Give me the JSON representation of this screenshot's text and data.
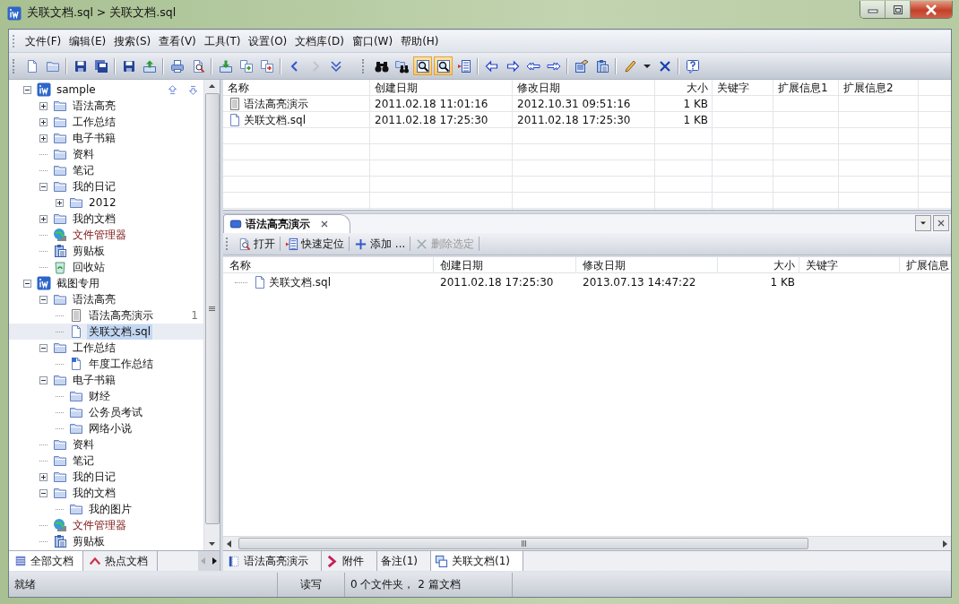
{
  "window": {
    "title": "关联文档.sql > 关联文档.sql"
  },
  "menu": [
    {
      "label": "文件(F)"
    },
    {
      "label": "编辑(E)"
    },
    {
      "label": "搜索(S)"
    },
    {
      "label": "查看(V)"
    },
    {
      "label": "工具(T)"
    },
    {
      "label": "设置(O)"
    },
    {
      "label": "文档库(D)"
    },
    {
      "label": "窗口(W)"
    },
    {
      "label": "帮助(H)"
    }
  ],
  "toolbar": [
    {
      "kind": "new",
      "pressed": false,
      "disabled": false
    },
    {
      "kind": "open",
      "pressed": false,
      "disabled": false
    },
    {
      "kind": "separator"
    },
    {
      "kind": "save",
      "pressed": false,
      "disabled": false
    },
    {
      "kind": "saveall",
      "pressed": false,
      "disabled": false
    },
    {
      "kind": "separator"
    },
    {
      "kind": "savedisk",
      "pressed": false,
      "disabled": false
    },
    {
      "kind": "export",
      "pressed": false,
      "disabled": false
    },
    {
      "kind": "separator"
    },
    {
      "kind": "print",
      "pressed": false,
      "disabled": false
    },
    {
      "kind": "preview",
      "pressed": false,
      "disabled": false
    },
    {
      "kind": "separator"
    },
    {
      "kind": "import",
      "pressed": false,
      "disabled": false
    },
    {
      "kind": "copy",
      "pressed": false,
      "disabled": false
    },
    {
      "kind": "move",
      "pressed": false,
      "disabled": false
    },
    {
      "kind": "separator"
    },
    {
      "kind": "back",
      "pressed": false,
      "disabled": false
    },
    {
      "kind": "forward",
      "pressed": false,
      "disabled": true
    },
    {
      "kind": "expand",
      "pressed": false,
      "disabled": false
    },
    {
      "kind": "grip"
    },
    {
      "kind": "find",
      "pressed": false,
      "disabled": false
    },
    {
      "kind": "findfolder",
      "pressed": false,
      "disabled": false
    },
    {
      "kind": "zoom",
      "pressed": true,
      "disabled": false
    },
    {
      "kind": "search",
      "pressed": true,
      "disabled": false
    },
    {
      "kind": "locate",
      "pressed": false,
      "disabled": false
    },
    {
      "kind": "separator"
    },
    {
      "kind": "prev",
      "pressed": false,
      "disabled": false
    },
    {
      "kind": "next",
      "pressed": false,
      "disabled": false
    },
    {
      "kind": "first",
      "pressed": false,
      "disabled": false
    },
    {
      "kind": "last",
      "pressed": false,
      "disabled": false
    },
    {
      "kind": "separator"
    },
    {
      "kind": "properties",
      "pressed": false,
      "disabled": false
    },
    {
      "kind": "paste",
      "pressed": false,
      "disabled": false
    },
    {
      "kind": "separator"
    },
    {
      "kind": "edit",
      "pressed": false,
      "disabled": false
    },
    {
      "kind": "dropdown",
      "pressed": false,
      "disabled": false
    },
    {
      "kind": "delete",
      "pressed": false,
      "disabled": false
    },
    {
      "kind": "separator"
    },
    {
      "kind": "help",
      "pressed": false,
      "disabled": false
    }
  ],
  "tree": [
    {
      "label": "sample",
      "kind": "library",
      "expanded": true,
      "selected": false,
      "children": [
        {
          "label": "语法高亮",
          "kind": "folder",
          "expanded": false,
          "selected": false
        },
        {
          "label": "工作总结",
          "kind": "folder",
          "expanded": false,
          "selected": false
        },
        {
          "label": "电子书籍",
          "kind": "folder",
          "expanded": false,
          "selected": false
        },
        {
          "label": "资料",
          "kind": "folder",
          "selected": false
        },
        {
          "label": "笔记",
          "kind": "folder",
          "selected": false
        },
        {
          "label": "我的日记",
          "kind": "folder",
          "expanded": true,
          "selected": false,
          "children": [
            {
              "label": "2012",
              "kind": "folder",
              "expanded": false,
              "selected": false
            }
          ]
        },
        {
          "label": "我的文档",
          "kind": "folder",
          "expanded": false,
          "selected": false
        },
        {
          "label": "文件管理器",
          "kind": "filemanager",
          "selected": false
        },
        {
          "label": "剪贴板",
          "kind": "clipboard",
          "selected": false
        },
        {
          "label": "回收站",
          "kind": "recycle",
          "selected": false
        }
      ]
    },
    {
      "label": "截图专用",
      "kind": "library",
      "expanded": true,
      "selected": false,
      "children": [
        {
          "label": "语法高亮",
          "kind": "folder",
          "expanded": true,
          "selected": false,
          "children": [
            {
              "label": "语法高亮演示",
              "kind": "note",
              "selected": false,
              "count": "1"
            },
            {
              "label": "关联文档.sql",
              "kind": "file",
              "selected": true
            }
          ]
        },
        {
          "label": "工作总结",
          "kind": "folder",
          "expanded": true,
          "selected": false,
          "children": [
            {
              "label": "年度工作总结",
              "kind": "summary",
              "selected": false
            }
          ]
        },
        {
          "label": "电子书籍",
          "kind": "folder",
          "expanded": true,
          "selected": false,
          "children": [
            {
              "label": "财经",
              "kind": "folder",
              "selected": false
            },
            {
              "label": "公务员考试",
              "kind": "folder",
              "selected": false
            },
            {
              "label": "网络小说",
              "kind": "folder",
              "selected": false
            }
          ]
        },
        {
          "label": "资料",
          "kind": "folder",
          "selected": false
        },
        {
          "label": "笔记",
          "kind": "folder",
          "selected": false
        },
        {
          "label": "我的日记",
          "kind": "folder",
          "expanded": false,
          "selected": false
        },
        {
          "label": "我的文档",
          "kind": "folder",
          "expanded": true,
          "selected": false,
          "children": [
            {
              "label": "我的图片",
              "kind": "folder",
              "selected": false
            }
          ]
        },
        {
          "label": "文件管理器",
          "kind": "filemanager",
          "selected": false
        },
        {
          "label": "剪贴板",
          "kind": "clipboard",
          "selected": false
        }
      ]
    }
  ],
  "sidebar_tabs": [
    {
      "label": "全部文档",
      "selected": true
    },
    {
      "label": "热点文档",
      "selected": false
    }
  ],
  "file_list": {
    "columns": [
      "名称",
      "创建日期",
      "修改日期",
      "大小",
      "关键字",
      "扩展信息1",
      "扩展信息2"
    ],
    "rows": [
      {
        "kind": "note",
        "cells": [
          "语法高亮演示",
          "2011.02.18 11:01:16",
          "2012.10.31 09:51:16",
          "1 KB"
        ]
      },
      {
        "kind": "file",
        "cells": [
          "关联文档.sql",
          "2011.02.18 17:25:30",
          "2011.02.18 17:25:30",
          "1 KB"
        ]
      }
    ]
  },
  "document_panel": {
    "title": "语法高亮演示",
    "toolbar": [
      {
        "kind": "open",
        "label": "打开",
        "disabled": false
      },
      {
        "kind": "locate",
        "label": "快速定位",
        "disabled": false
      },
      {
        "kind": "add",
        "label": "添加 ...",
        "disabled": false
      },
      {
        "kind": "delete",
        "label": "删除选定",
        "disabled": true
      }
    ],
    "file_list": {
      "columns": [
        "名称",
        "创建日期",
        "修改日期",
        "大小",
        "关键字",
        "扩展信息"
      ],
      "rows": [
        {
          "kind": "file",
          "cells": [
            "关联文档.sql",
            "2011.02.18 17:25:30",
            "2013.07.13 14:47:22",
            "1 KB"
          ]
        }
      ]
    },
    "tabs": [
      {
        "kind": "syntax",
        "label": "语法高亮演示",
        "selected": false
      },
      {
        "kind": "attachment",
        "label": "附件",
        "selected": false
      },
      {
        "kind": "note",
        "label": "备注(1)",
        "selected": false
      },
      {
        "kind": "related",
        "label": "关联文档(1)",
        "selected": true
      }
    ]
  },
  "status_bar": [
    "就绪",
    "读写",
    "0 个文件夹， 2 篇文档"
  ]
}
